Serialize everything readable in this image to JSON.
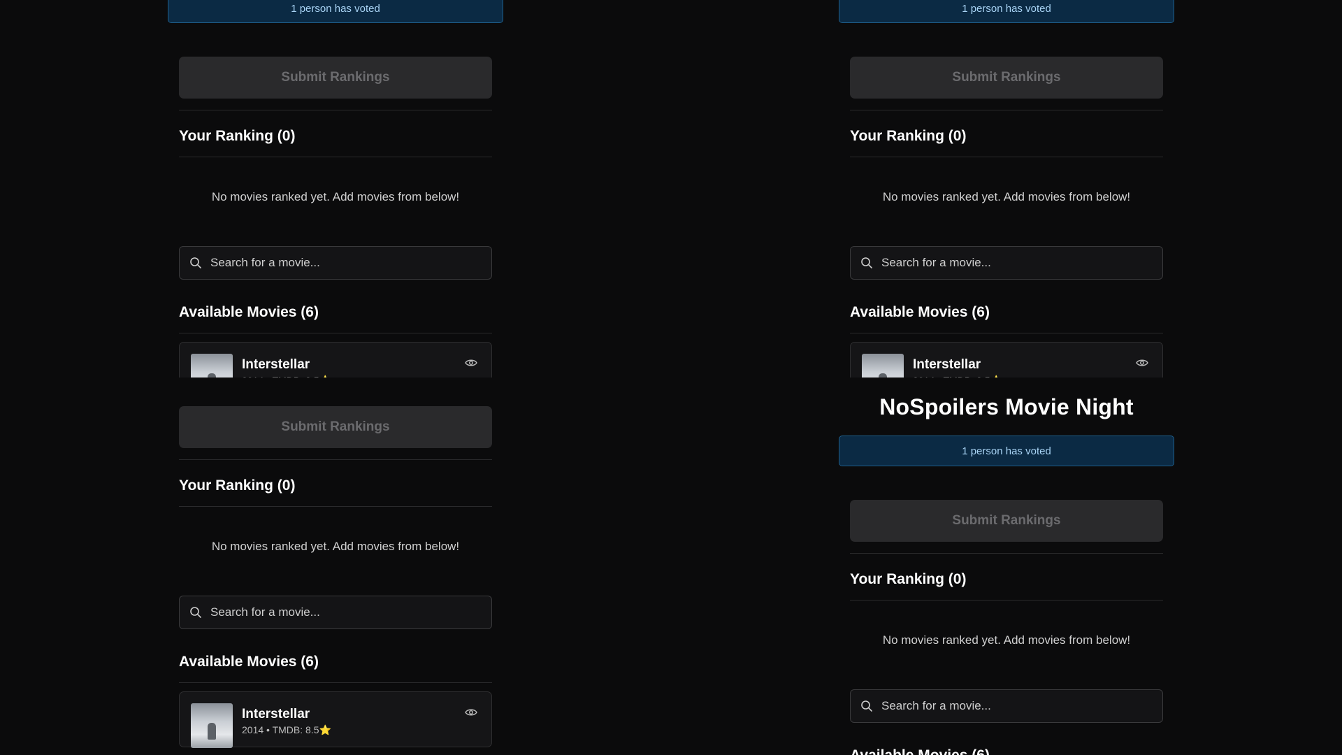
{
  "app": {
    "title": "NoSpoilers Movie Night",
    "voted_text": "1 person has voted"
  },
  "actions": {
    "submit_label": "Submit Rankings"
  },
  "ranking": {
    "title": "Your Ranking (0)",
    "empty_message": "No movies ranked yet. Add movies from below!"
  },
  "search": {
    "placeholder": "Search for a movie..."
  },
  "available": {
    "title": "Available Movies (6)",
    "movies": [
      {
        "title": "Interstellar",
        "meta": "2014 • TMDB: 8.5⭐"
      }
    ]
  },
  "icons": {
    "search": "search-icon",
    "eye": "eye-icon"
  },
  "colors": {
    "background": "#0b0b0c",
    "banner_bg": "#0b2a44",
    "banner_border": "#1f5f8c",
    "banner_text": "#a9d4f5",
    "button_disabled": "#2a2a2c"
  }
}
